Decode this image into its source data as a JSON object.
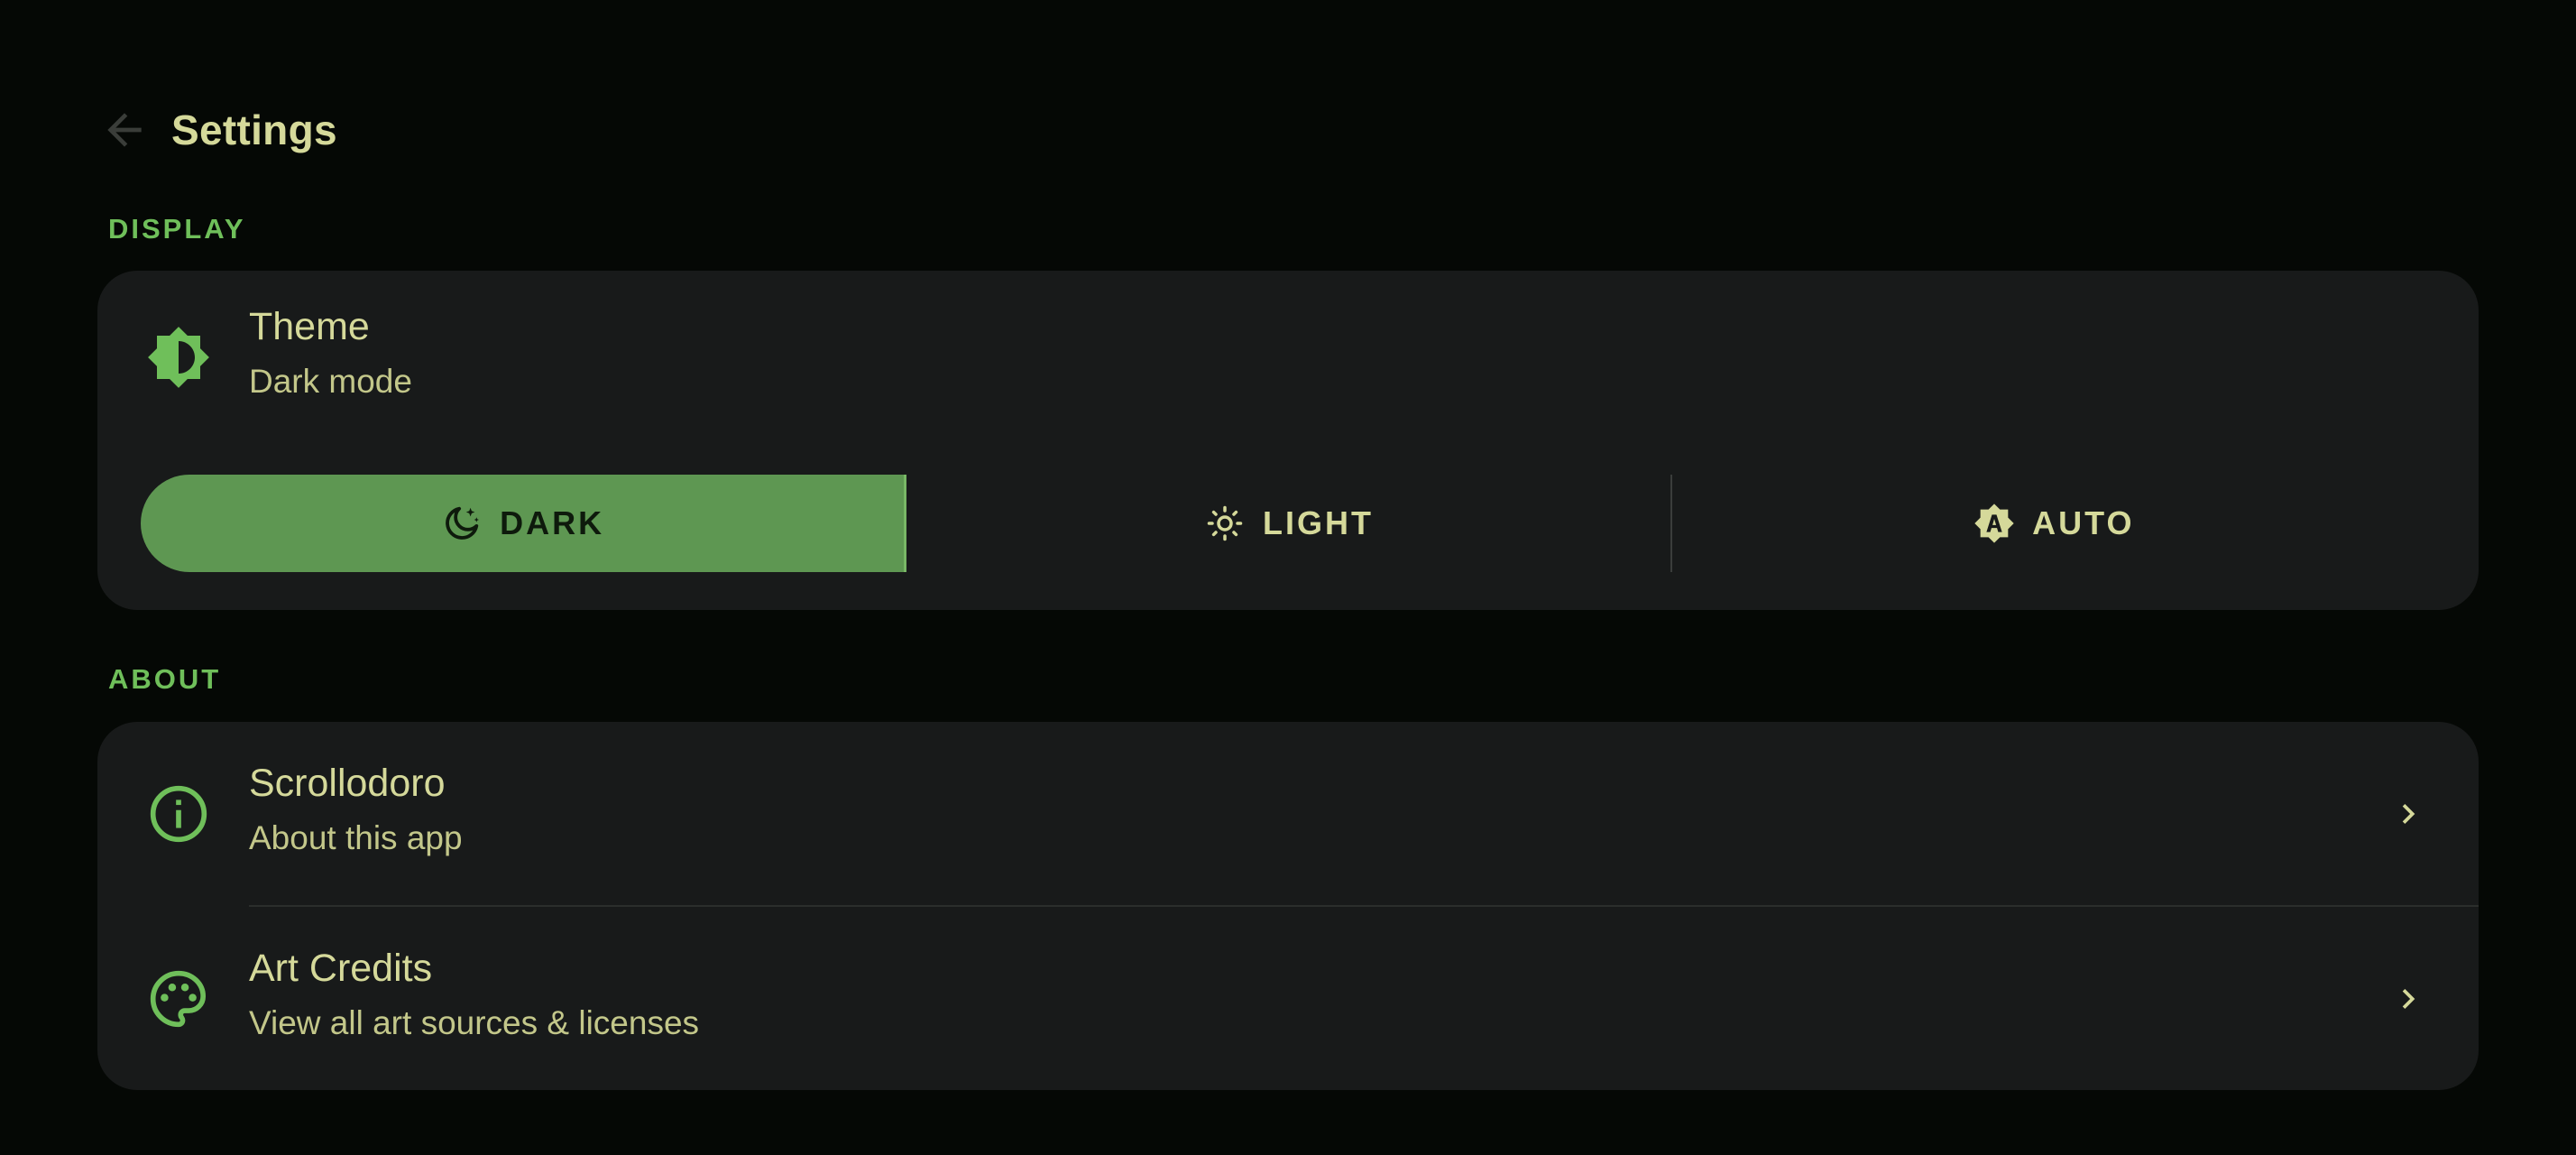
{
  "header": {
    "title": "Settings",
    "back_icon": "arrow-left-icon"
  },
  "sections": {
    "display": {
      "label": "DISPLAY",
      "theme": {
        "icon": "brightness-half-icon",
        "title": "Theme",
        "subtitle": "Dark mode",
        "options": [
          {
            "label": "DARK",
            "icon": "moon-stars-icon",
            "selected": true
          },
          {
            "label": "LIGHT",
            "icon": "sun-icon",
            "selected": false
          },
          {
            "label": "AUTO",
            "icon": "brightness-auto-icon",
            "selected": false
          }
        ]
      }
    },
    "about": {
      "label": "ABOUT",
      "items": [
        {
          "icon": "info-icon",
          "title": "Scrollodoro",
          "subtitle": "About this app"
        },
        {
          "icon": "palette-icon",
          "title": "Art Credits",
          "subtitle": "View all art sources & licenses"
        }
      ]
    }
  },
  "colors": {
    "background": "#050805",
    "card": "#181a1a",
    "accent": "#6fbf5a",
    "text": "#d5d99a",
    "selected_segment": "#5e9752"
  }
}
